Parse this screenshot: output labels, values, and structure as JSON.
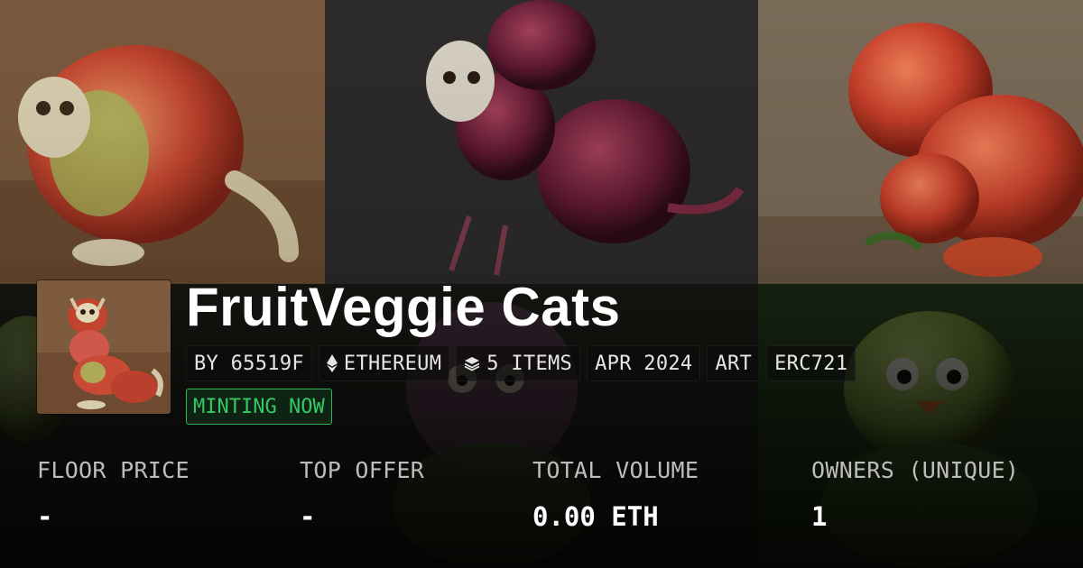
{
  "collection": {
    "title": "FruitVeggie Cats"
  },
  "tags": [
    {
      "label": "BY 65519F",
      "icon": ""
    },
    {
      "label": "ETHEREUM",
      "icon": "ethereum-icon"
    },
    {
      "label": "5 ITEMS",
      "icon": "layers-icon"
    },
    {
      "label": "APR 2024",
      "icon": ""
    },
    {
      "label": "ART",
      "icon": ""
    },
    {
      "label": "ERC721",
      "icon": ""
    }
  ],
  "status": {
    "label": "MINTING NOW",
    "color": "#35c864"
  },
  "stats": [
    {
      "label": "FLOOR PRICE",
      "value": "-"
    },
    {
      "label": "TOP OFFER",
      "value": "-"
    },
    {
      "label": "TOTAL VOLUME",
      "value": "0.00 ETH"
    },
    {
      "label": "OWNERS (UNIQUE)",
      "value": "1"
    }
  ],
  "background": {
    "images": [
      "apple-creature",
      "beet-creature",
      "tomato-creature",
      "fig-creature",
      "pear-creature"
    ]
  }
}
